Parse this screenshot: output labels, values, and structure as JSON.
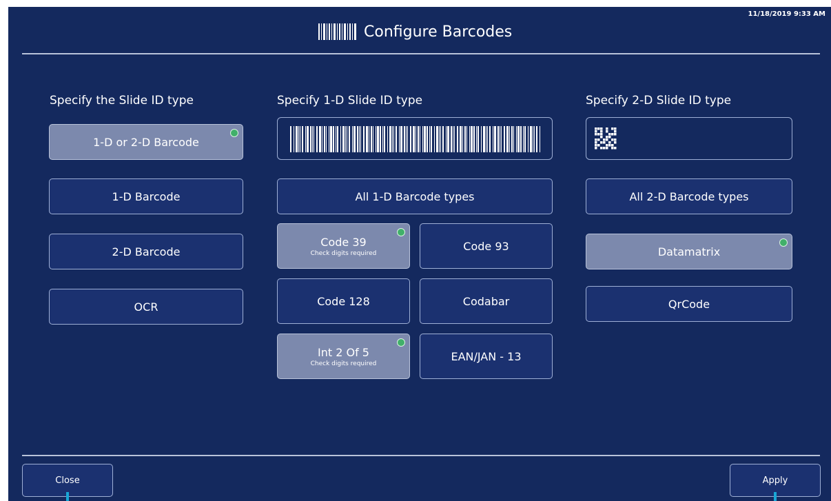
{
  "header": {
    "title": "Configure Barcodes",
    "timestamp": "11/18/2019 9:33 AM"
  },
  "columns": {
    "slide_id": {
      "heading": "Specify the Slide ID type",
      "buttons": [
        {
          "label": "1-D or 2-D Barcode",
          "selected": true
        },
        {
          "label": "1-D Barcode",
          "selected": false
        },
        {
          "label": "2-D Barcode",
          "selected": false
        },
        {
          "label": "OCR",
          "selected": false
        }
      ]
    },
    "one_d": {
      "heading": "Specify 1-D Slide ID type",
      "all_label": "All 1-D Barcode types",
      "types": [
        {
          "label": "Code 39",
          "sub": "Check digits required",
          "selected": true
        },
        {
          "label": "Code 93",
          "sub": "",
          "selected": false
        },
        {
          "label": "Code 128",
          "sub": "",
          "selected": false
        },
        {
          "label": "Codabar",
          "sub": "",
          "selected": false
        },
        {
          "label": "Int 2 Of 5",
          "sub": "Check digits required",
          "selected": true
        },
        {
          "label": "EAN/JAN - 13",
          "sub": "",
          "selected": false
        }
      ]
    },
    "two_d": {
      "heading": "Specify 2-D Slide ID type",
      "all_label": "All 2-D Barcode types",
      "types": [
        {
          "label": "Datamatrix",
          "selected": true
        },
        {
          "label": "QrCode",
          "selected": false
        }
      ]
    }
  },
  "footer": {
    "close_label": "Close",
    "apply_label": "Apply"
  },
  "icons": {
    "title": "barcode-icon",
    "selected": "selected-indicator-icon",
    "one_d_preview": "barcode-preview-icon",
    "two_d_preview": "qr-code-preview-icon"
  },
  "colors": {
    "background": "#14295e",
    "button": "#1b3170",
    "selected": "#7c89ad",
    "indicator": "#41b06a",
    "accent": "#19a7d6"
  }
}
